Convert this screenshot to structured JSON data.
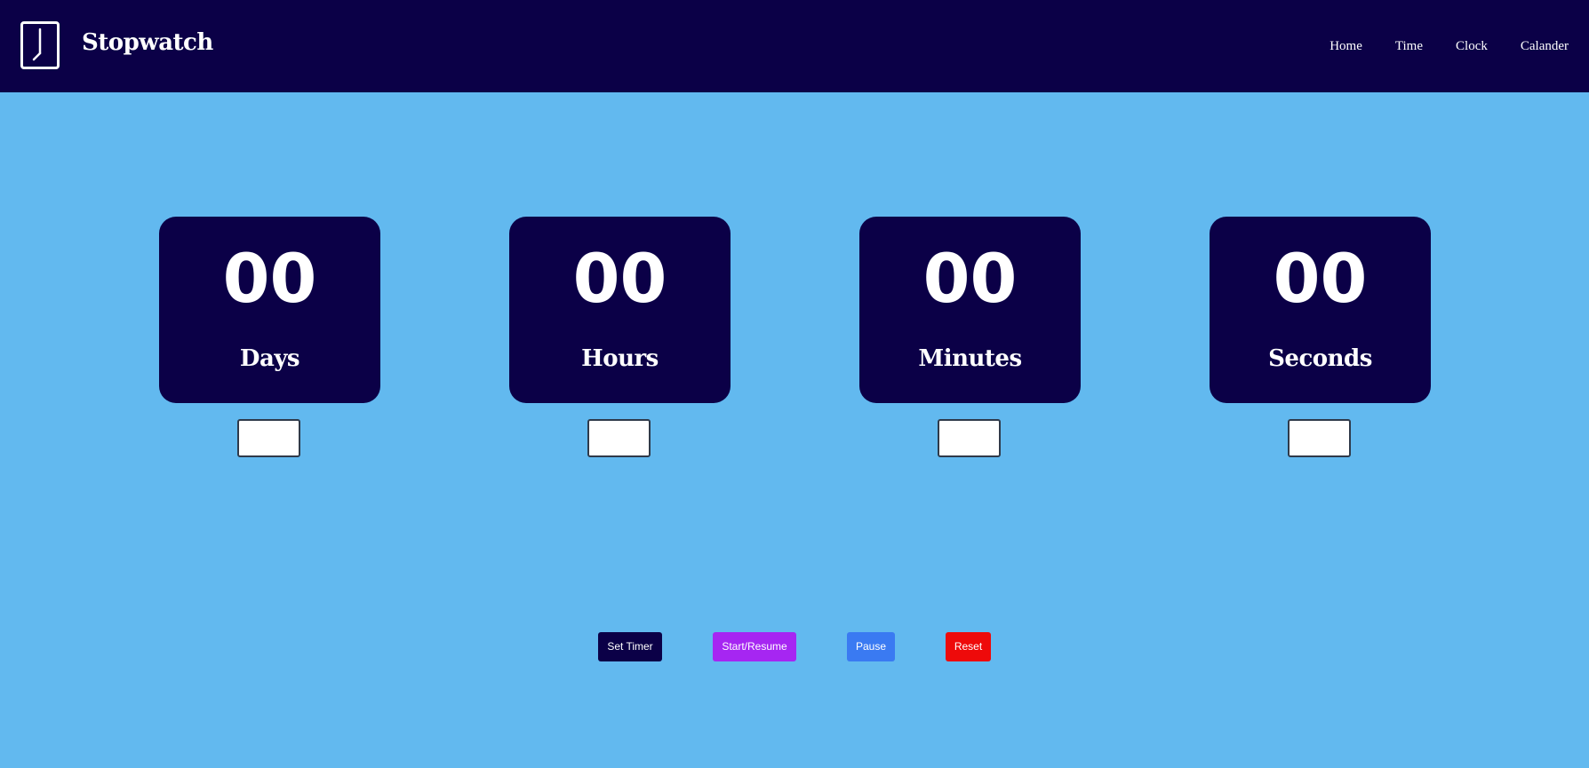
{
  "header": {
    "logo_icon": "clock-icon",
    "title": "Stopwatch",
    "nav": [
      {
        "label": "Home"
      },
      {
        "label": "Time"
      },
      {
        "label": "Clock"
      },
      {
        "label": "Calander"
      }
    ]
  },
  "timer": {
    "units": [
      {
        "value": "00",
        "label": "Days",
        "input_value": ""
      },
      {
        "value": "00",
        "label": "Hours",
        "input_value": ""
      },
      {
        "value": "00",
        "label": "Minutes",
        "input_value": ""
      },
      {
        "value": "00",
        "label": "Seconds",
        "input_value": ""
      }
    ]
  },
  "controls": {
    "set_timer": "Set Timer",
    "start_resume": "Start/Resume",
    "pause": "Pause",
    "reset": "Reset"
  },
  "colors": {
    "page_background": "#62b9ef",
    "navbar": "#0b0047",
    "card": "#0b0047",
    "set_timer_button": "#0b0047",
    "start_resume_button": "#a626f2",
    "pause_button": "#3a7af2",
    "reset_button": "#ee0a0a"
  }
}
